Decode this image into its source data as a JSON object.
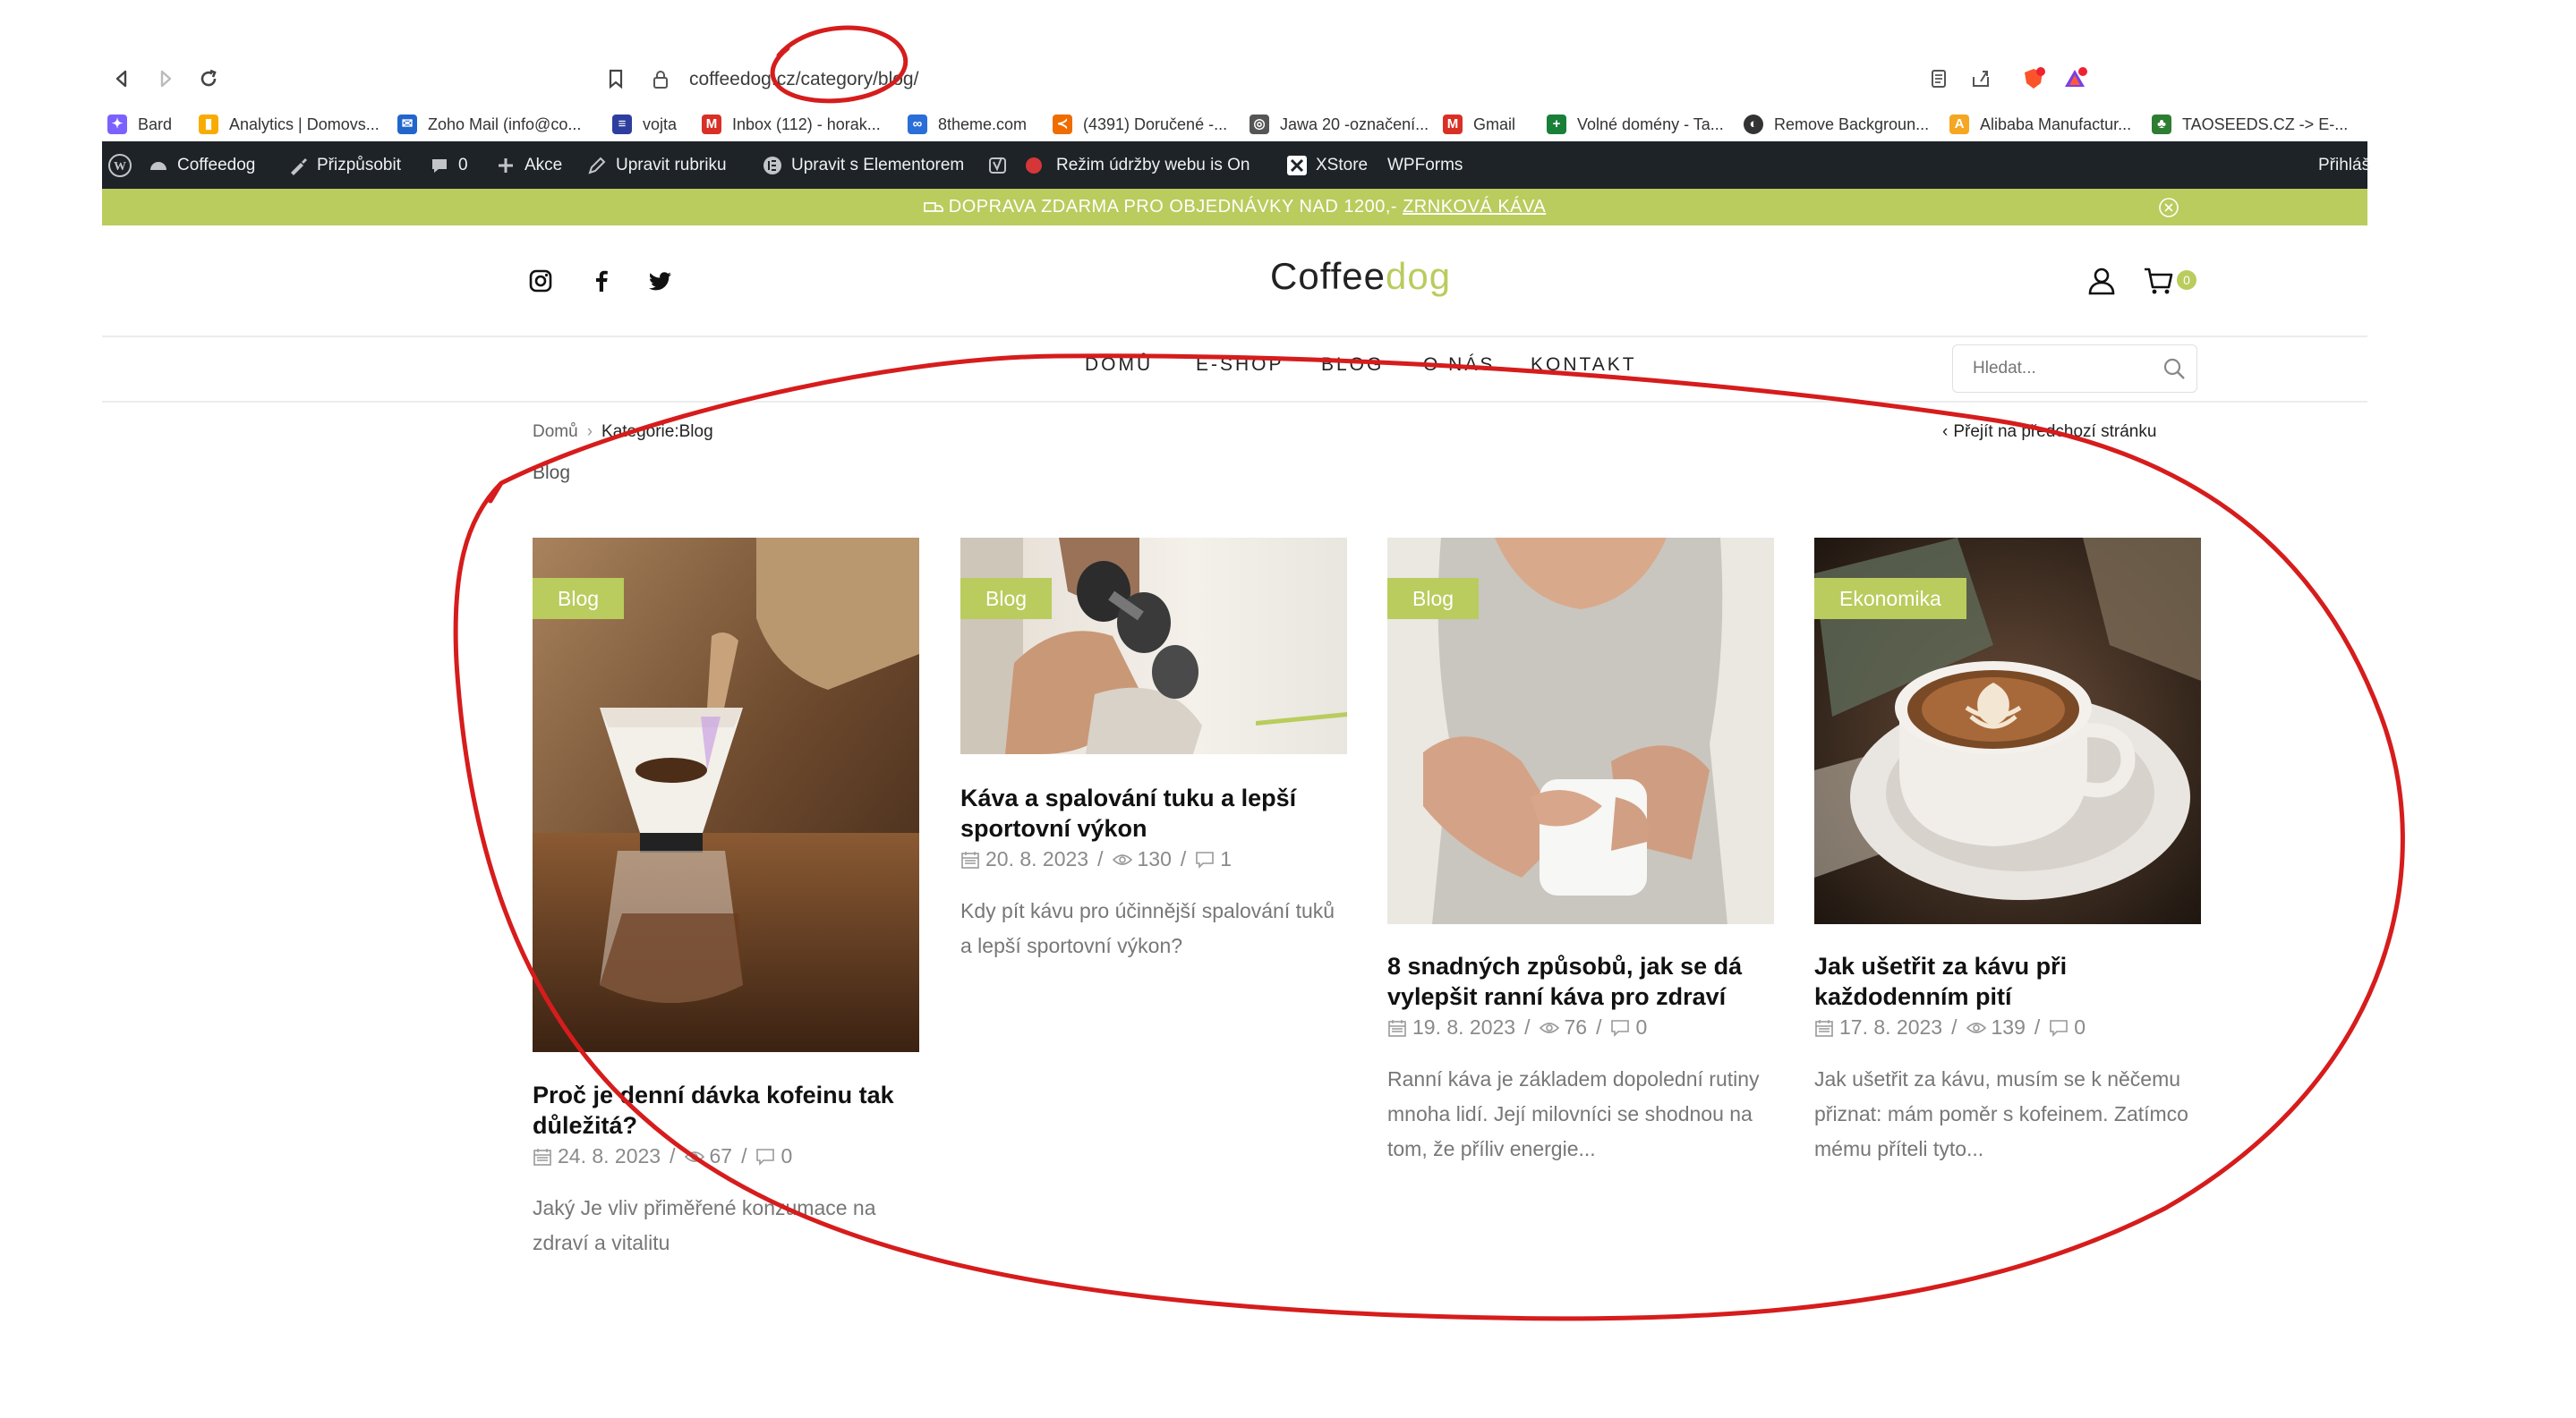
{
  "browser": {
    "url": "coffeedog.cz/category/blog/",
    "bookmarks": [
      {
        "label": "Bard",
        "icon": "sparkle-icon",
        "color": "#7b61ff"
      },
      {
        "label": "Analytics | Domovs...",
        "icon": "analytics-icon",
        "color": "#f9ab00"
      },
      {
        "label": "Zoho Mail (info@co...",
        "icon": "mail-icon",
        "color": "#2266cc"
      },
      {
        "label": "vojta",
        "icon": "bookmark-icon",
        "color": "#2d3e9e"
      },
      {
        "label": "Inbox (112) - horak...",
        "icon": "gmail-icon",
        "color": "#d93025"
      },
      {
        "label": "8theme.com",
        "icon": "theme-icon",
        "color": "#2b6dd9"
      },
      {
        "label": "(4391) Doručené -...",
        "icon": "envelope-icon",
        "color": "#ef6c00"
      },
      {
        "label": "Jawa 20 -označení...",
        "icon": "wheel-icon",
        "color": "#555555"
      },
      {
        "label": "Gmail",
        "icon": "gmail-icon",
        "color": "#d93025"
      },
      {
        "label": "Volné domény - Ta...",
        "icon": "sheet-icon",
        "color": "#188038"
      },
      {
        "label": "Remove Backgroun...",
        "icon": "globe-icon",
        "color": "#333333"
      },
      {
        "label": "Alibaba Manufactur...",
        "icon": "alibaba-icon",
        "color": "#f5a623"
      },
      {
        "label": "TAOSEEDS.CZ -> E-...",
        "icon": "plant-icon",
        "color": "#2e7d32"
      }
    ]
  },
  "adminbar": {
    "items": [
      {
        "label": "Coffeedog",
        "icon": "dashboard-icon"
      },
      {
        "label": "Přizpůsobit",
        "icon": "brush-icon"
      },
      {
        "label": "0",
        "icon": "comment-icon"
      },
      {
        "label": "Akce",
        "icon": "plus-icon"
      },
      {
        "label": "Upravit rubriku",
        "icon": "pencil-icon"
      },
      {
        "label": "Upravit s Elementorem",
        "icon": "elementor-icon"
      },
      {
        "label": "Režim údržby webu is On",
        "icon": "yoast-icon"
      },
      {
        "label": "XStore",
        "icon": "xstore-icon"
      },
      {
        "label": "WPForms",
        "icon": ""
      }
    ],
    "right_label": "Přihláš"
  },
  "promo": {
    "text": "DOPRAVA ZDARMA PRO OBJEDNÁVKY NAD 1200,-",
    "link": "ZRNKOVÁ KÁVA"
  },
  "header": {
    "logo_main": "Coffee",
    "logo_accent": "dog",
    "cart_count": "0",
    "menu": [
      "DOMŮ",
      "E-SHOP",
      "BLOG",
      "O NÁS",
      "KONTAKT"
    ],
    "search_placeholder": "Hledat..."
  },
  "breadcrumb": {
    "home": "Domů",
    "current": "Kategorie:Blog",
    "back": "Přejít na předchozí stránku"
  },
  "page_heading": "Blog",
  "posts": [
    {
      "category": "Blog",
      "title": "Proč je denní dávka kofeinu tak důležitá?",
      "date": "24. 8. 2023",
      "views": "67",
      "comments": "0",
      "excerpt": "Jaký Je vliv přiměřené konzumace na zdraví a vitalitu"
    },
    {
      "category": "Blog",
      "title": "Káva a spalování tuku a lepší sportovní výkon",
      "date": "20. 8. 2023",
      "views": "130",
      "comments": "1",
      "excerpt": "Kdy pít kávu pro účinnější spalování tuků a lepší sportovní výkon?"
    },
    {
      "category": "Blog",
      "title": "8 snadných způsobů, jak se dá vylepšit ranní káva pro zdraví",
      "date": "19. 8. 2023",
      "views": "76",
      "comments": "0",
      "excerpt": "Ranní káva je základem dopolední rutiny mnoha lidí. Její milovníci se shodnou na tom, že příliv energie..."
    },
    {
      "category": "Ekonomika",
      "title": "Jak ušetřit za kávu při každodenním pití",
      "date": "17. 8. 2023",
      "views": "139",
      "comments": "0",
      "excerpt": "Jak ušetřit za kávu, musím se k něčemu přiznat: mám poměr s kofeinem. Zatímco mému příteli tyto..."
    }
  ],
  "colors": {
    "accent": "#b9cc5d",
    "adminbar": "#1d2327",
    "annotation": "#d61c1c"
  }
}
